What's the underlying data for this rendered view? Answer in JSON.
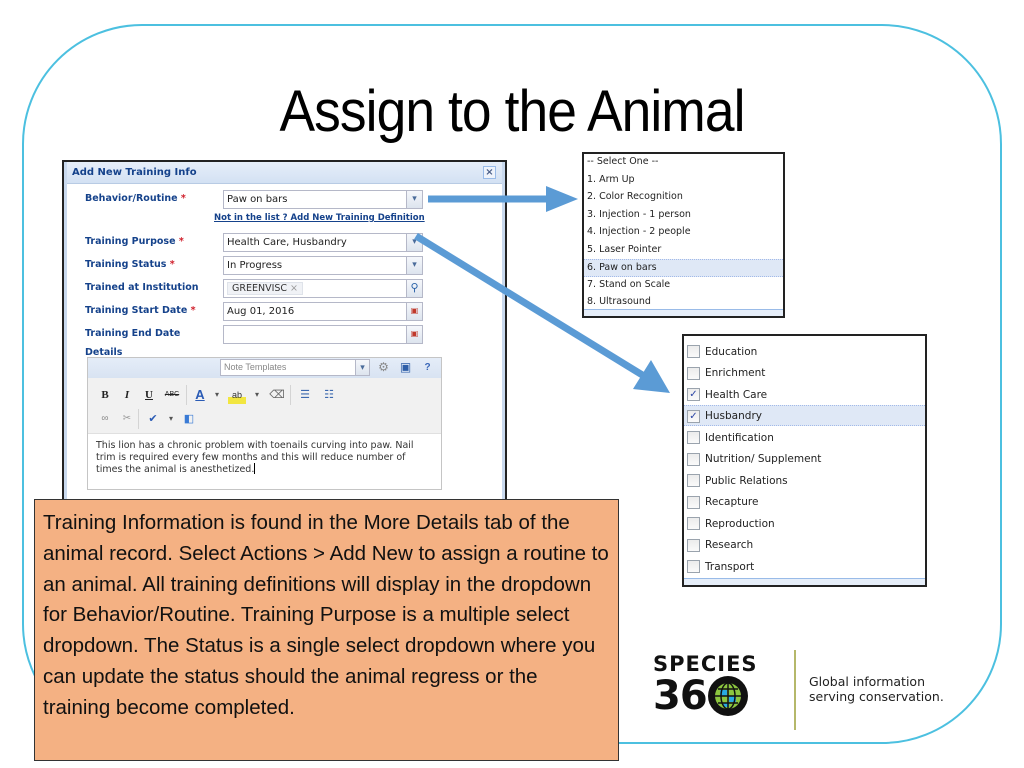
{
  "slide": {
    "title": "Assign to the Animal"
  },
  "dialog": {
    "title": "Add New Training Info",
    "close_icon": "close-icon",
    "fields": [
      {
        "label": "Behavior/Routine",
        "required": true,
        "value": "Paw on bars",
        "type": "dropdown"
      },
      {
        "label": "Training Purpose",
        "required": true,
        "value": "Health Care, Husbandry",
        "type": "dropdown"
      },
      {
        "label": "Training Status",
        "required": true,
        "value": "In Progress",
        "type": "dropdown"
      },
      {
        "label": "Trained at Institution",
        "required": false,
        "value": "GREENVISC",
        "type": "search"
      },
      {
        "label": "Training Start Date",
        "required": true,
        "value": "Aug 01, 2016",
        "type": "date"
      },
      {
        "label": "Training End Date",
        "required": false,
        "value": "",
        "type": "date"
      }
    ],
    "required_marker": "*",
    "add_definition_link": "Not in the list ? Add New Training Definition",
    "details_label": "Details",
    "editor": {
      "note_templates_placeholder": "Note Templates",
      "toolbar": {
        "bold": "B",
        "italic": "I",
        "underline": "U",
        "strikethrough": "ABC",
        "font_color": "A",
        "highlight": "ab"
      },
      "text": "This lion has a chronic problem with toenails curving into paw. Nail trim is required every few months and this will reduce number of times the animal is anesthetized."
    }
  },
  "behavior_list": {
    "items": [
      "-- Select One --",
      "1. Arm Up",
      "2. Color Recognition",
      "3. Injection - 1 person",
      "4. Injection - 2 people",
      "5. Laser Pointer",
      "6. Paw on bars",
      "7. Stand on Scale",
      "8. Ultrasound"
    ],
    "selected_index": 6
  },
  "purpose_list": {
    "items": [
      {
        "label": "Education",
        "checked": false
      },
      {
        "label": "Enrichment",
        "checked": false
      },
      {
        "label": "Health Care",
        "checked": true
      },
      {
        "label": "Husbandry",
        "checked": true
      },
      {
        "label": "Identification",
        "checked": false
      },
      {
        "label": "Nutrition/ Supplement",
        "checked": false
      },
      {
        "label": "Public Relations",
        "checked": false
      },
      {
        "label": "Recapture",
        "checked": false
      },
      {
        "label": "Reproduction",
        "checked": false
      },
      {
        "label": "Research",
        "checked": false
      },
      {
        "label": "Transport",
        "checked": false
      }
    ],
    "highlighted_index": 3,
    "check_glyph": "✓"
  },
  "callout": {
    "text": "Training Information is found in the More Details tab of the animal record. Select Actions > Add New to assign a routine to an animal. All training definitions will display in the dropdown for Behavior/Routine. Training Purpose is a multiple select dropdown. The Status is a single select dropdown where you can update the status should the animal regress or the training become completed."
  },
  "logo": {
    "line1": "SPECIES",
    "line2": "36",
    "tagline_1": "Global information",
    "tagline_2": "serving conservation."
  },
  "colors": {
    "frame": "#4cc0e0",
    "arrow": "#5b9bd5",
    "callout_bg": "#f4b183",
    "label_blue": "#15428b",
    "required_red": "#d0202c",
    "selection_bg": "#dfe8f6"
  }
}
